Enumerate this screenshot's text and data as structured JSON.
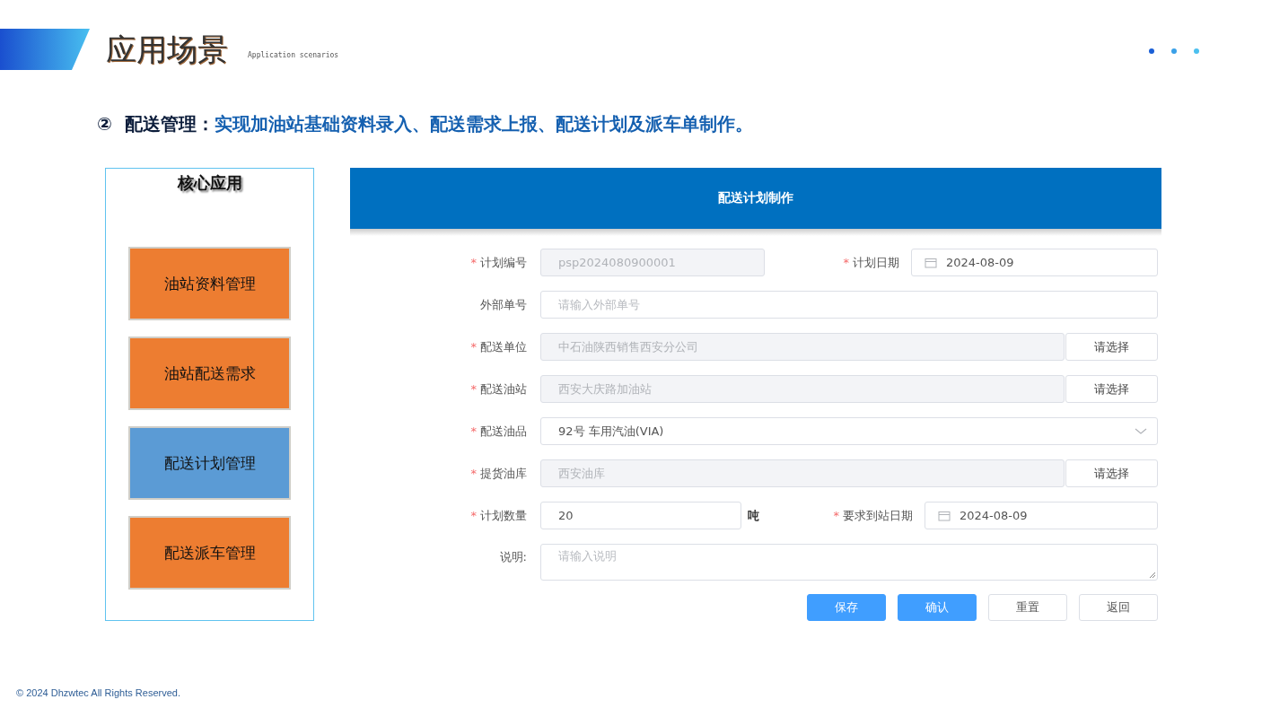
{
  "header": {
    "title": "应用场景",
    "subtitle": "Application scenarios"
  },
  "heading": {
    "marker": "②",
    "title": "配送管理：",
    "text": "实现加油站基础资料录入、配送需求上报、配送计划及派车单制作。"
  },
  "sidebar": {
    "title": "核心应用",
    "items": [
      {
        "label": "油站资料管理",
        "selected": false
      },
      {
        "label": "油站配送需求",
        "selected": false
      },
      {
        "label": "配送计划管理",
        "selected": true
      },
      {
        "label": "配送派车管理",
        "selected": false
      }
    ]
  },
  "form": {
    "title": "配送计划制作",
    "rows": [
      {
        "kind": "split",
        "mark": "*",
        "label": "计划编号",
        "value": "psp2024080900001",
        "disabled": true,
        "right": {
          "mark": "*",
          "label": "计划日期",
          "value": "2024-08-09"
        }
      },
      {
        "kind": "text",
        "label": "外部单号",
        "placeholder": "请输入外部单号",
        "disabled": false
      },
      {
        "kind": "picker",
        "mark": "*",
        "label": "配送单位",
        "value": "中石油陕西销售西安分公司",
        "disabled": true,
        "button": "请选择"
      },
      {
        "kind": "picker",
        "mark": "*",
        "label": "配送油站",
        "value": "西安大庆路加油站",
        "disabled": true,
        "button": "请选择"
      },
      {
        "kind": "select",
        "mark": "*",
        "label": "配送油品",
        "value": "92号 车用汽油(VIA)",
        "disabled": false
      },
      {
        "kind": "picker",
        "mark": "*",
        "label": "提货油库",
        "value": "西安油库",
        "disabled": true,
        "button": "请选择"
      },
      {
        "kind": "split",
        "mark": "*",
        "label": "计划数量",
        "value": "20",
        "disabled": false,
        "unit": "吨",
        "right": {
          "mark": "*",
          "label": "要求到站日期",
          "value": "2024-08-09"
        }
      },
      {
        "kind": "textarea",
        "label": "说明:",
        "placeholder": "请输入说明",
        "disabled": false
      }
    ],
    "buttons": [
      {
        "label": "保存",
        "primary": true
      },
      {
        "label": "确认",
        "primary": true
      },
      {
        "label": "重置",
        "primary": false
      },
      {
        "label": "返回",
        "primary": false
      }
    ]
  },
  "footer": "© 2024  Dhzwtec All Rights Reserved."
}
